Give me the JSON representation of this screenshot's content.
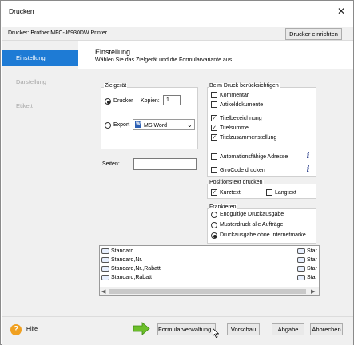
{
  "window": {
    "title": "Drucken",
    "close_glyph": "✕"
  },
  "printer": {
    "label": "Drucker: Brother MFC-J6930DW Printer",
    "setup_button": "Drucker einrichten"
  },
  "sidebar": {
    "items": [
      {
        "label": "Einstellung",
        "active": true
      },
      {
        "label": "Darstellung",
        "active": false
      },
      {
        "label": "Etikett",
        "active": false
      }
    ]
  },
  "header": {
    "title": "Einstellung",
    "subtitle": "Wählen Sie das Zielgerät und die Formularvariante aus."
  },
  "zielgeraet": {
    "label": "Zielgerät",
    "drucker_label": "Drucker",
    "kopien_label": "Kopien:",
    "kopien_value": "1",
    "export_label": "Export",
    "export_format": "MS Word",
    "seiten_label": "Seiten:",
    "seiten_value": ""
  },
  "beim_druck": {
    "label": "Beim Druck berücksichtigen",
    "options": [
      {
        "label": "Kommentar",
        "checked": false
      },
      {
        "label": "Artikeldokumente",
        "checked": false
      },
      {
        "label": "Titelbezeichnung",
        "checked": true
      },
      {
        "label": "Titelsumme",
        "checked": true
      },
      {
        "label": "Titelzusammenstellung",
        "checked": true
      },
      {
        "label": "Automationsfähige Adresse",
        "checked": false
      },
      {
        "label": "GiroCode drucken",
        "checked": false
      }
    ]
  },
  "positionstext": {
    "label": "Positionstext drucken",
    "options": [
      {
        "label": "Kurztext",
        "checked": true
      },
      {
        "label": "Langtext",
        "checked": false
      }
    ]
  },
  "frankieren": {
    "label": "Frankieren",
    "options": [
      {
        "label": "Endgültige Druckausgabe",
        "selected": false
      },
      {
        "label": "Musterdruck alle Aufträge",
        "selected": false
      },
      {
        "label": "Druckausgabe ohne Internetmarke",
        "selected": true
      }
    ]
  },
  "form_list": {
    "rows": [
      {
        "left": "Standard",
        "right": "Standa"
      },
      {
        "left": "Standard,Nr.",
        "right": "Standa"
      },
      {
        "left": "Standard,Nr.,Rabatt",
        "right": "Standa"
      },
      {
        "left": "Standard,Rabatt",
        "right": "Standa"
      }
    ]
  },
  "footer": {
    "help_label": "Hilfe",
    "formular_button": "Formularverwaltung...",
    "vorschau_button": "Vorschau",
    "abgabe_button": "Abgabe",
    "abbrechen_button": "Abbrechen"
  },
  "colors": {
    "accent": "#1e7bd5",
    "arrow": "#6cbf2a",
    "help": "#f0a020"
  }
}
